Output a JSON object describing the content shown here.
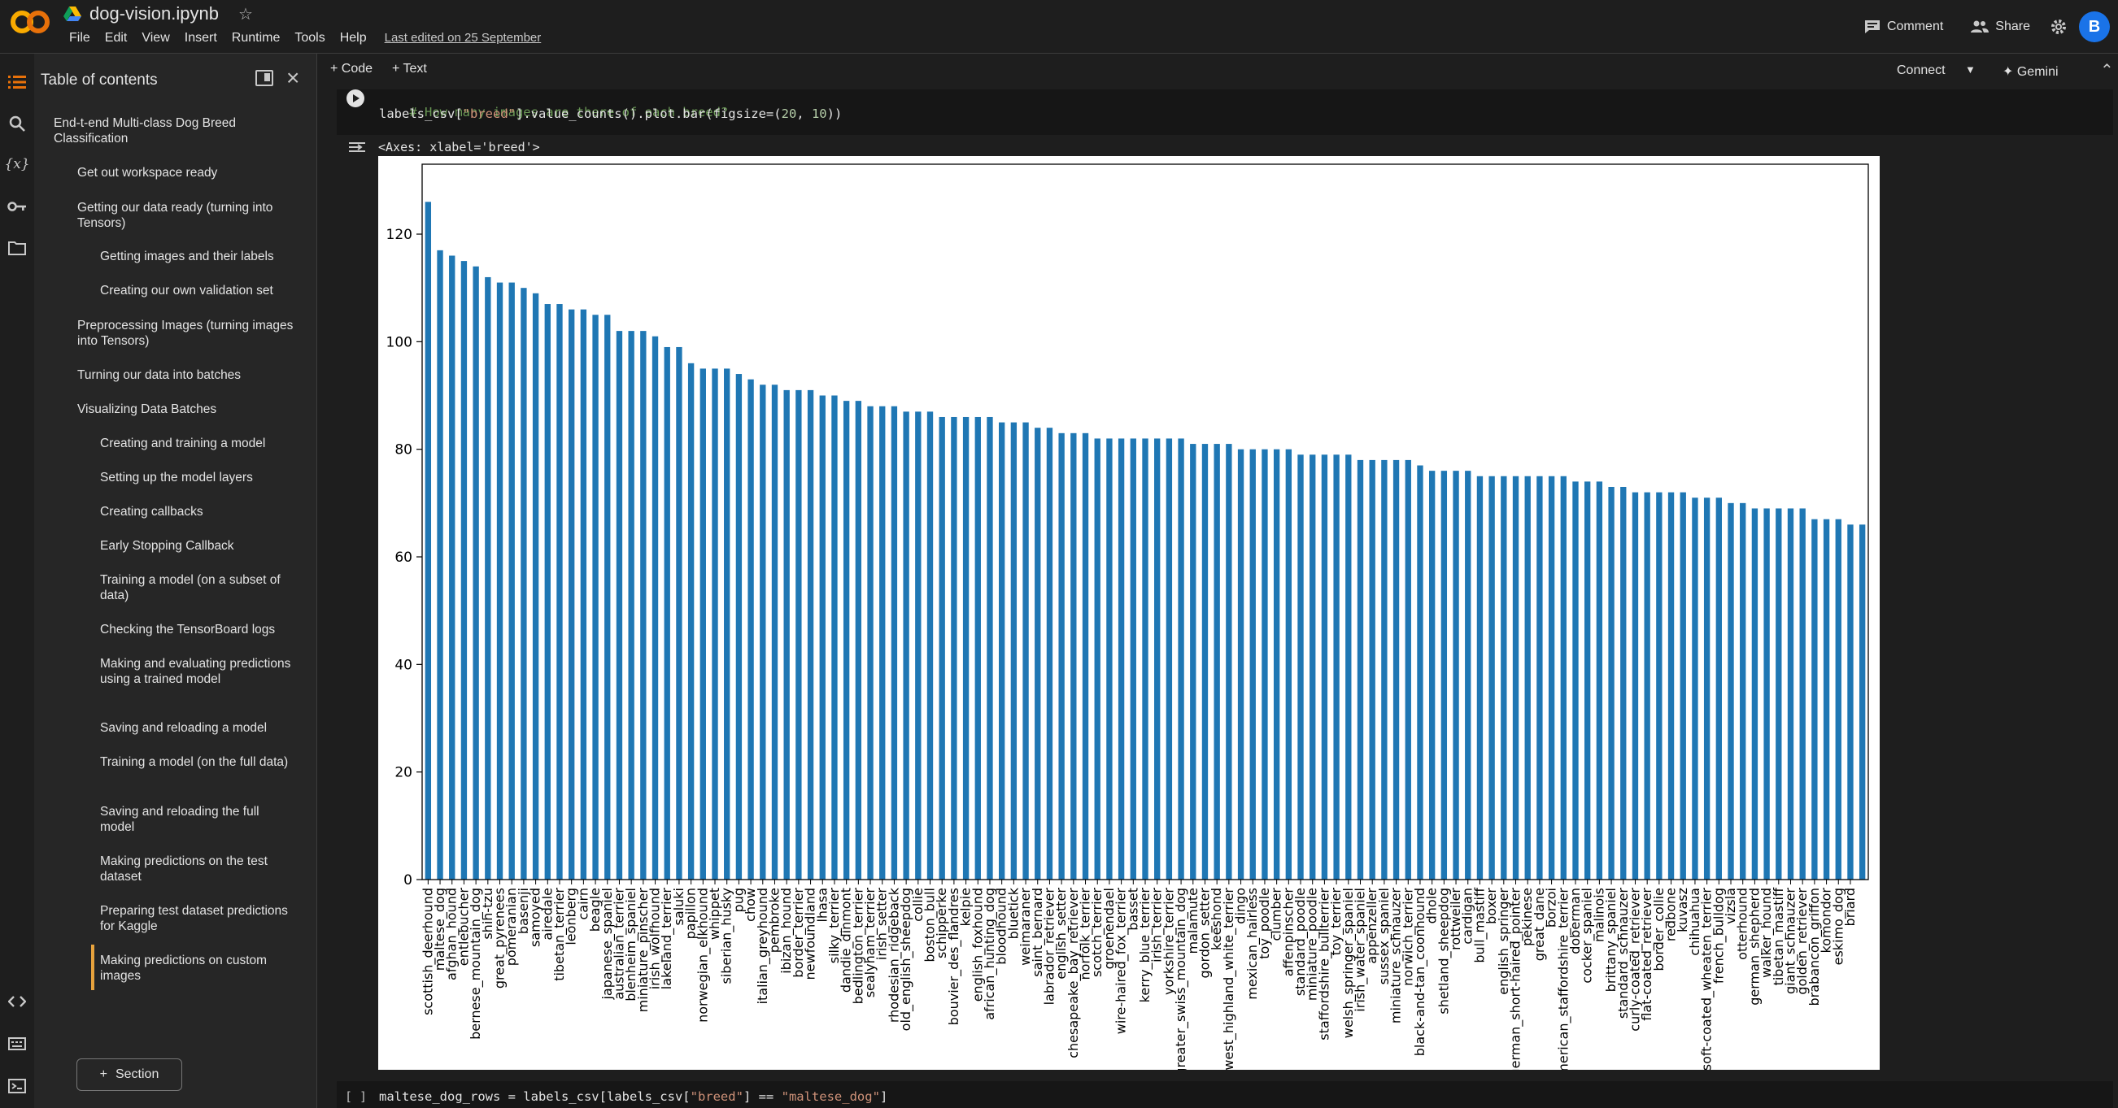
{
  "header": {
    "notebook_title": "dog-vision.ipynb",
    "menu": [
      "File",
      "Edit",
      "View",
      "Insert",
      "Runtime",
      "Tools",
      "Help"
    ],
    "last_edited": "Last edited on 25 September",
    "comment_label": "Comment",
    "share_label": "Share",
    "avatar_letter": "B"
  },
  "toc": {
    "title": "Table of contents",
    "items": [
      {
        "label": "End-t-end Multi-class Dog Breed Classification",
        "level": 1
      },
      {
        "label": "Get out workspace ready",
        "level": 2
      },
      {
        "label": "Getting our data ready (turning into Tensors)",
        "level": 2
      },
      {
        "label": "Getting images and their labels",
        "level": 3
      },
      {
        "label": "Creating our own validation set",
        "level": 3
      },
      {
        "label": "Preprocessing Images (turning images into Tensors)",
        "level": 2
      },
      {
        "label": "Turning our data into batches",
        "level": 2
      },
      {
        "label": "Visualizing Data Batches",
        "level": 2
      },
      {
        "label": "Creating and training a model",
        "level": 3
      },
      {
        "label": "Setting up the model layers",
        "level": 3
      },
      {
        "label": "Creating callbacks",
        "level": 3
      },
      {
        "label": "Early Stopping Callback",
        "level": 3
      },
      {
        "label": "Training a model (on a subset of data)",
        "level": 3
      },
      {
        "label": "Checking the TensorBoard logs",
        "level": 3
      },
      {
        "label": "Making and evaluating predictions using a trained model",
        "level": 3
      },
      {
        "label": "Saving and reloading a model",
        "level": 3
      },
      {
        "label": "Training a model (on the full data)",
        "level": 3
      },
      {
        "label": "Saving and reloading the full model",
        "level": 3
      },
      {
        "label": "Making predictions on the test dataset",
        "level": 3
      },
      {
        "label": "Preparing test dataset predictions for Kaggle",
        "level": 3
      },
      {
        "label": "Making predictions on custom images",
        "level": 3
      }
    ],
    "section_button": "Section"
  },
  "toolbar": {
    "code_button": "+ Code",
    "text_button": "+ Text",
    "connect": "Connect",
    "gemini": "Gemini"
  },
  "cell1": {
    "comment": "# How many images are there of each breed?",
    "code_a": "labels_csv[",
    "code_str": "\"breed\"",
    "code_b": "].value_counts().plot.bar(figsize=(",
    "code_n1": "20",
    "code_sep": ", ",
    "code_n2": "10",
    "code_c": "))",
    "output_text": "<Axes: xlabel='breed'>"
  },
  "cell2": {
    "bracket": "[ ]",
    "code_a": "maltese_dog_rows = labels_csv[labels_csv[",
    "code_str1": "\"breed\"",
    "code_b": "] == ",
    "code_str2": "\"maltese_dog\"",
    "code_c": "]"
  },
  "chart_data": {
    "type": "bar",
    "title": "",
    "xlabel": "breed",
    "ylabel": "",
    "ylim": [
      0,
      133
    ],
    "yticks": [
      0,
      20,
      40,
      60,
      80,
      100,
      120
    ],
    "bar_color": "#1f77b4",
    "categories": [
      "scottish_deerhound",
      "maltese_dog",
      "afghan_hound",
      "entlebucher",
      "bernese_mountain_dog",
      "shih-tzu",
      "great_pyrenees",
      "pomeranian",
      "basenji",
      "samoyed",
      "airedale",
      "tibetan_terrier",
      "leonberg",
      "cairn",
      "beagle",
      "japanese_spaniel",
      "australian_terrier",
      "blenheim_spaniel",
      "miniature_pinscher",
      "irish_wolfhound",
      "lakeland_terrier",
      "saluki",
      "papillon",
      "norwegian_elkhound",
      "whippet",
      "siberian_husky",
      "pug",
      "chow",
      "italian_greyhound",
      "pembroke",
      "ibizan_hound",
      "border_terrier",
      "newfoundland",
      "lhasa",
      "silky_terrier",
      "dandie_dinmont",
      "bedlington_terrier",
      "sealyham_terrier",
      "irish_setter",
      "rhodesian_ridgeback",
      "old_english_sheepdog",
      "collie",
      "boston_bull",
      "schipperke",
      "bouvier_des_flandres",
      "kelpie",
      "english_foxhound",
      "african_hunting_dog",
      "bloodhound",
      "bluetick",
      "weimaraner",
      "saint_bernard",
      "labrador_retriever",
      "english_setter",
      "chesapeake_bay_retriever",
      "norfolk_terrier",
      "scotch_terrier",
      "groenendael",
      "wire-haired_fox_terrier",
      "basset",
      "kerry_blue_terrier",
      "irish_terrier",
      "yorkshire_terrier",
      "greater_swiss_mountain_dog",
      "malamute",
      "gordon_setter",
      "keeshond",
      "west_highland_white_terrier",
      "dingo",
      "mexican_hairless",
      "toy_poodle",
      "clumber",
      "affenpinscher",
      "standard_poodle",
      "miniature_poodle",
      "staffordshire_bullterrier",
      "toy_terrier",
      "welsh_springer_spaniel",
      "irish_water_spaniel",
      "appenzeller",
      "sussex_spaniel",
      "miniature_schnauzer",
      "norwich_terrier",
      "black-and-tan_coonhound",
      "dhole",
      "shetland_sheepdog",
      "rottweiler",
      "cardigan",
      "bull_mastiff",
      "boxer",
      "english_springer",
      "german_short-haired_pointer",
      "pekinese",
      "great_dane",
      "borzoi",
      "american_staffordshire_terrier",
      "doberman",
      "cocker_spaniel",
      "malinois",
      "brittany_spaniel",
      "standard_schnauzer",
      "curly-coated_retriever",
      "flat-coated_retriever",
      "border_collie",
      "redbone",
      "kuvasz",
      "chihuahua",
      "soft-coated_wheaten_terrier",
      "french_bulldog",
      "vizsla",
      "otterhound",
      "german_shepherd",
      "walker_hound",
      "tibetan_mastiff",
      "giant_schnauzer",
      "golden_retriever",
      "brabancon_griffon",
      "komondor",
      "eskimo_dog",
      "briard"
    ],
    "values": [
      126,
      117,
      116,
      115,
      114,
      112,
      111,
      111,
      110,
      109,
      107,
      107,
      106,
      106,
      105,
      105,
      102,
      102,
      102,
      101,
      99,
      99,
      96,
      95,
      95,
      95,
      94,
      93,
      92,
      92,
      91,
      91,
      91,
      90,
      90,
      89,
      89,
      88,
      88,
      88,
      87,
      87,
      87,
      86,
      86,
      86,
      86,
      86,
      85,
      85,
      85,
      84,
      84,
      83,
      83,
      83,
      82,
      82,
      82,
      82,
      82,
      82,
      82,
      82,
      81,
      81,
      81,
      81,
      80,
      80,
      80,
      80,
      80,
      79,
      79,
      79,
      79,
      79,
      78,
      78,
      78,
      78,
      78,
      77,
      76,
      76,
      76,
      76,
      75,
      75,
      75,
      75,
      75,
      75,
      75,
      75,
      74,
      74,
      74,
      73,
      73,
      72,
      72,
      72,
      72,
      72,
      71,
      71,
      71,
      70,
      70,
      69,
      69,
      69,
      69,
      69,
      67,
      67,
      67,
      66,
      66
    ]
  }
}
